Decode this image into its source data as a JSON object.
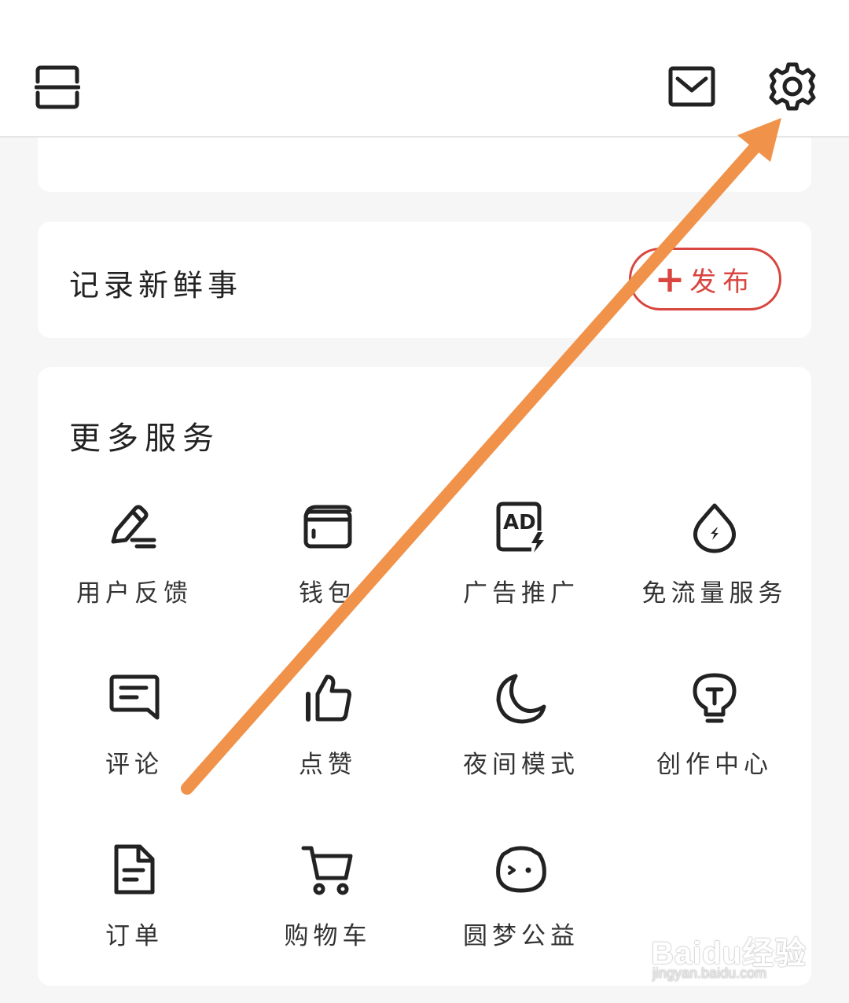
{
  "topbar": {
    "scan_icon": "scan-icon",
    "mail_icon": "mail-icon",
    "settings_icon": "gear-icon"
  },
  "post": {
    "prompt": "记录新鲜事",
    "publish_plus": "+",
    "publish_label": "发布",
    "accent_color": "#d9453f"
  },
  "services": {
    "title": "更多服务",
    "items": [
      {
        "label": "用户反馈",
        "icon": "feedback-pencil-icon"
      },
      {
        "label": "钱包",
        "icon": "wallet-icon"
      },
      {
        "label": "广告推广",
        "icon": "ad-icon"
      },
      {
        "label": "免流量服务",
        "icon": "data-drop-icon"
      },
      {
        "label": "评论",
        "icon": "comment-icon"
      },
      {
        "label": "点赞",
        "icon": "thumbs-up-icon"
      },
      {
        "label": "夜间模式",
        "icon": "moon-icon"
      },
      {
        "label": "创作中心",
        "icon": "lightbulb-icon"
      },
      {
        "label": "订单",
        "icon": "document-icon"
      },
      {
        "label": "购物车",
        "icon": "cart-icon"
      },
      {
        "label": "圆梦公益",
        "icon": "charity-mascot-icon"
      }
    ]
  },
  "ad_icon_text": "AD",
  "annotation_arrow_color": "#f0924a",
  "watermark": {
    "logo": "Baidu经验",
    "url": "jingyan.baidu.com"
  }
}
